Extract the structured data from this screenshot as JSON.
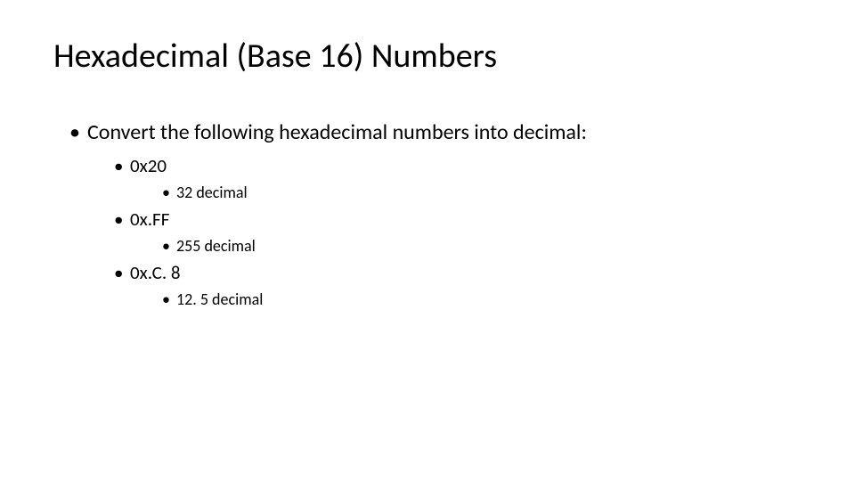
{
  "title": "Hexadecimal (Base 16) Numbers",
  "intro": "Convert the following hexadecimal numbers into decimal:",
  "items": [
    {
      "hex": "0x20",
      "dec": "32 decimal"
    },
    {
      "hex": "0x.FF",
      "dec": "255 decimal"
    },
    {
      "hex": "0x.C. 8",
      "dec": "12. 5 decimal"
    }
  ]
}
